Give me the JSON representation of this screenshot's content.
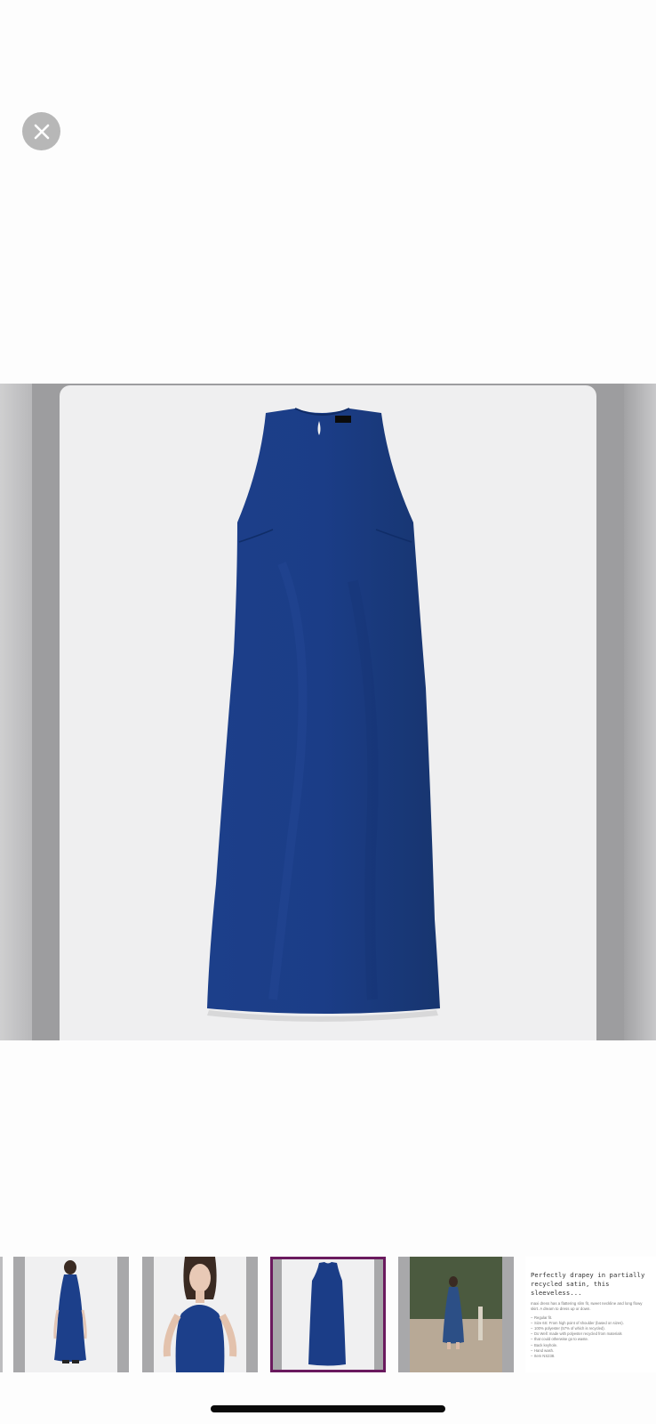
{
  "viewer": {
    "close_icon": "close-icon"
  },
  "main_image": {
    "alt": "Navy satin sleeveless dress",
    "brand_label": "Madewell",
    "dress_color": "#1b3d87",
    "background_color": "#efeff0"
  },
  "thumbnails": [
    {
      "id": "back-view",
      "selected": false,
      "alt": "Model wearing dress, back view"
    },
    {
      "id": "model-closeup",
      "selected": false,
      "alt": "Model wearing dress, close up"
    },
    {
      "id": "flat-lay",
      "selected": true,
      "alt": "Dress flat lay"
    },
    {
      "id": "street-view",
      "selected": false,
      "alt": "Model wearing dress outdoors"
    }
  ],
  "details_thumbnail": {
    "heading": "Perfectly drapey in partially recycled satin, this sleeveless...",
    "body": "maxi dress has a flattering slim fit, sweet neckline and long flowy skirt. A dream to dress up or down.",
    "bullets": [
      "Regular fit.",
      "Size 6S: From high point of shoulder (based on sizes).",
      "100% polyester (57% of which is recycled).",
      "Do Well: made with polyester recycled from materials",
      "that could otherwise go to waste.",
      "Back keyhole.",
      "Hand wash.",
      "Item NS238."
    ]
  },
  "accent_color": "#6a1a5e"
}
